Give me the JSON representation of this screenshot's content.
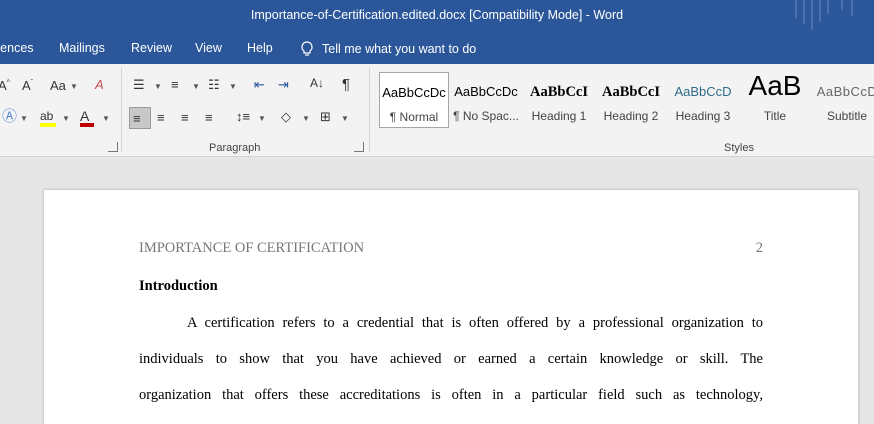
{
  "window": {
    "title": "Importance-of-Certification.edited.docx [Compatibility Mode]  -  Word"
  },
  "tabs": {
    "references": "rences",
    "mailings": "Mailings",
    "review": "Review",
    "view": "View",
    "help": "Help",
    "tell_me": "Tell me what you want to do"
  },
  "ribbon": {
    "font_group": {
      "change_case": "Aa",
      "clear_format": "A"
    },
    "paragraph_label": "Paragraph",
    "styles_label": "Styles",
    "styles": [
      {
        "sample": "AaBbCcDc",
        "name": "¶ Normal"
      },
      {
        "sample": "AaBbCcDc",
        "name": "¶ No Spac..."
      },
      {
        "sample": "AaBbCcI",
        "name": "Heading 1"
      },
      {
        "sample": "AaBbCcI",
        "name": "Heading 2"
      },
      {
        "sample": "AaBbCcD",
        "name": "Heading 3"
      },
      {
        "sample": "AaB",
        "name": "Title"
      },
      {
        "sample": "AaBbCcD",
        "name": "Subtitle"
      }
    ],
    "colors": {
      "highlight": "#ffff00",
      "font_color": "#c00000"
    }
  },
  "document": {
    "header_text": "IMPORTANCE OF CERTIFICATION",
    "page_number": "2",
    "heading": "Introduction",
    "lines": [
      "A certification refers to a credential that is often offered by a professional organization to",
      "individuals to show that you have achieved or earned a certain knowledge or skill. The",
      "organization that offers these accreditations is often in a particular field such as technology,"
    ]
  }
}
